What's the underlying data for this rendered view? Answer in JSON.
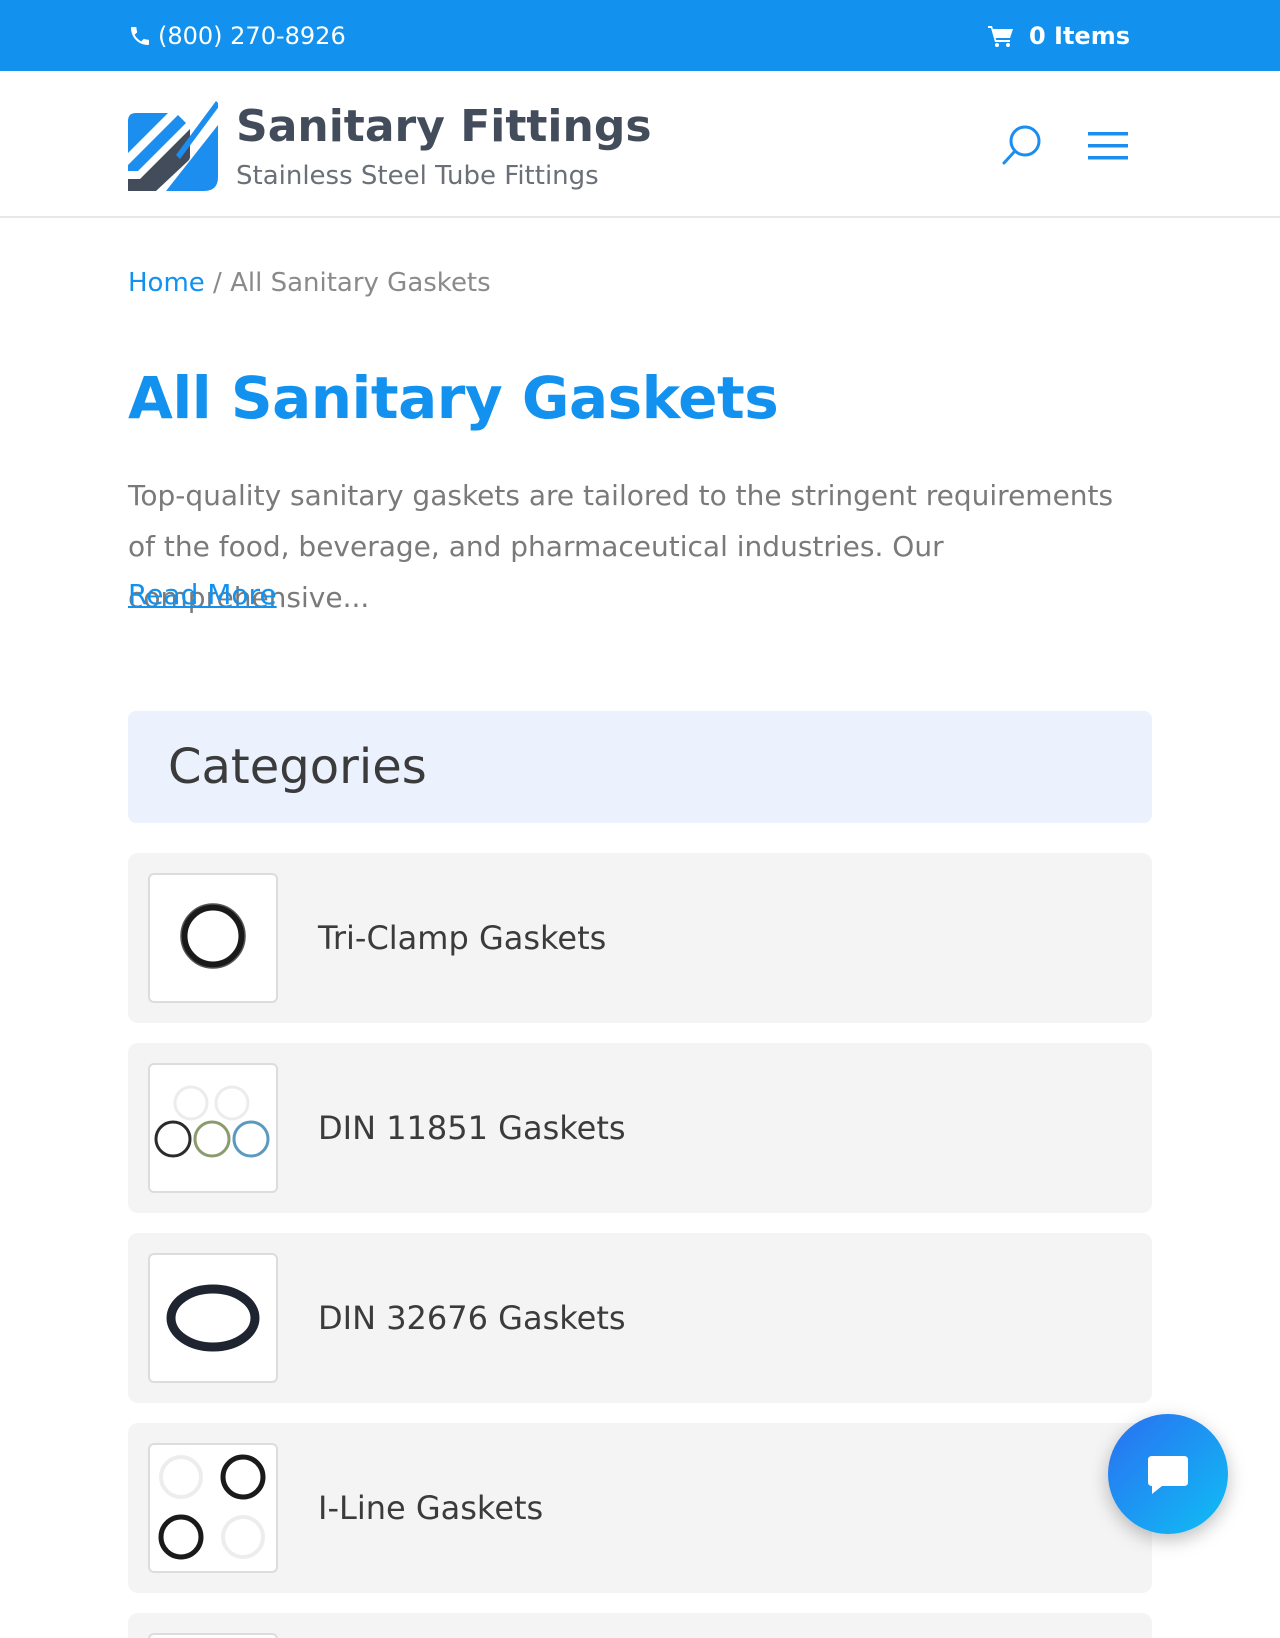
{
  "topbar": {
    "phone": "(800) 270-8926",
    "cart_label": "0 Items"
  },
  "header": {
    "brand_name": "Sanitary Fittings",
    "brand_tagline": "Stainless Steel Tube Fittings"
  },
  "breadcrumb": {
    "home": "Home",
    "separator": " / ",
    "current": "All Sanitary Gaskets"
  },
  "page": {
    "title": "All Sanitary Gaskets",
    "intro": "Top-quality sanitary gaskets are tailored to the stringent requirements of the food, beverage, and pharmaceutical industries. Our comprehensive...",
    "read_more": "Read More"
  },
  "categories": {
    "heading": "Categories",
    "items": [
      {
        "label": "Tri-Clamp Gaskets",
        "icon": "black-o-ring-icon"
      },
      {
        "label": "DIN 11851 Gaskets",
        "icon": "multicolor-o-rings-icon"
      },
      {
        "label": "DIN 32676 Gaskets",
        "icon": "oval-gasket-icon"
      },
      {
        "label": "I-Line Gaskets",
        "icon": "four-o-rings-icon"
      }
    ]
  },
  "colors": {
    "accent": "#1292ee",
    "topbar": "#1292ee",
    "brand_text": "#434c5b",
    "category_header_bg": "#ebf2fe",
    "category_item_bg": "#f4f4f4"
  }
}
